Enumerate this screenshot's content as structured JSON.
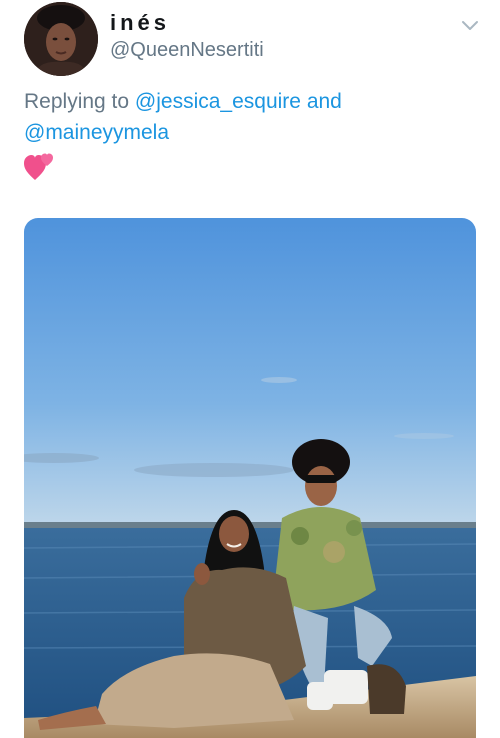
{
  "tweet": {
    "author": {
      "display_name": "inés",
      "handle": "@QueenNesertiti",
      "avatar_icon": "profile-avatar"
    },
    "menu_icon": "chevron-down-icon",
    "reply": {
      "prefix": "Replying to",
      "mention_1": "@jessica_esquire",
      "conjunction": "and",
      "mention_2": "@maineyymela"
    },
    "body_emoji_icon": "two-hearts-emoji",
    "media": {
      "type": "photo",
      "description_icon": "beach-photo"
    },
    "colors": {
      "link": "#1b95e0",
      "secondary_text": "#657786",
      "primary_text": "#14171a"
    }
  }
}
